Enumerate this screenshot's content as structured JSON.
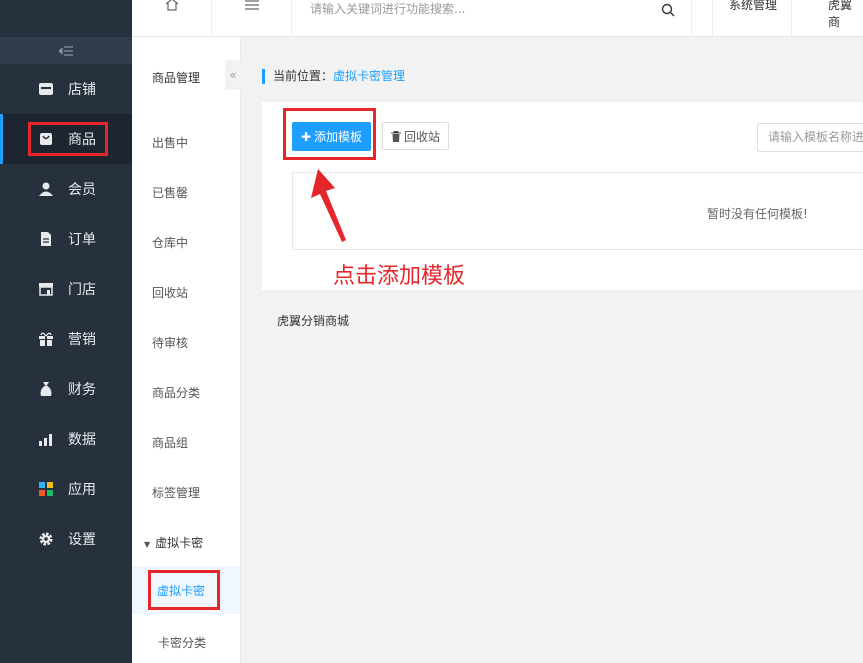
{
  "header": {
    "search_placeholder": "请输入关键词进行功能搜索...",
    "system_label": "系统管理",
    "shop_label": "虎翼商"
  },
  "sidebar": {
    "items": [
      {
        "label": "店铺",
        "icon": "store-icon"
      },
      {
        "label": "商品",
        "icon": "bag-icon"
      },
      {
        "label": "会员",
        "icon": "user-icon"
      },
      {
        "label": "订单",
        "icon": "document-icon"
      },
      {
        "label": "门店",
        "icon": "shop-icon"
      },
      {
        "label": "营销",
        "icon": "gift-icon"
      },
      {
        "label": "财务",
        "icon": "money-bag-icon"
      },
      {
        "label": "数据",
        "icon": "bar-chart-icon"
      },
      {
        "label": "应用",
        "icon": "apps-icon"
      },
      {
        "label": "设置",
        "icon": "gear-icon"
      }
    ]
  },
  "submenu": {
    "title": "商品管理",
    "items": [
      "出售中",
      "已售罄",
      "仓库中",
      "回收站",
      "待审核",
      "商品分类",
      "商品组",
      "标签管理"
    ],
    "group": "虚拟卡密",
    "active_item": "虚拟卡密",
    "last_item": "卡密分类"
  },
  "breadcrumb": {
    "prefix": "当前位置：",
    "current": "虚拟卡密管理"
  },
  "toolbar": {
    "add_label": "添加模板",
    "recycle_label": "回收站",
    "search_placeholder": "请输入模板名称进"
  },
  "empty_text": "暂时没有任何模板!",
  "annotation_text": "点击添加模板",
  "footer_text": "虎翼分销商城",
  "colors": {
    "accent": "#1e9fff",
    "highlight": "#e5262a",
    "sidebar_bg": "#27313e"
  }
}
